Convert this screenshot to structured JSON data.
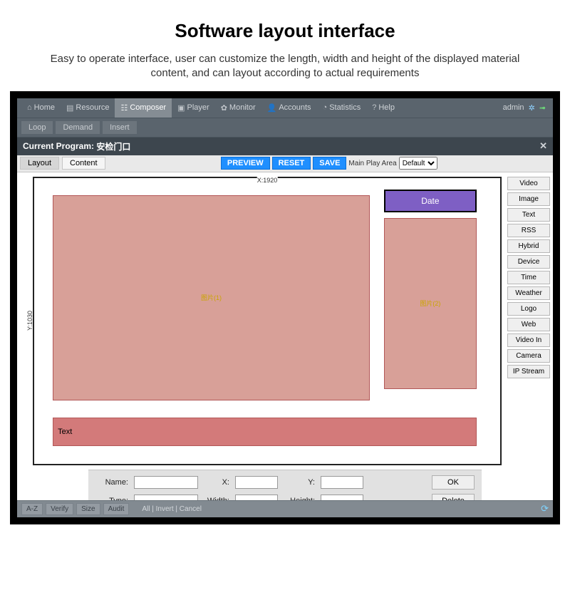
{
  "page": {
    "title": "Software layout interface",
    "subtitle": "Easy to operate interface, user can customize the length, width and height of the displayed material content, and can layout according to actual requirements"
  },
  "topnav": {
    "items": [
      {
        "label": "Home",
        "icon": "⌂"
      },
      {
        "label": "Resource",
        "icon": "▤"
      },
      {
        "label": "Composer",
        "icon": "☷",
        "active": true
      },
      {
        "label": "Player",
        "icon": "▣"
      },
      {
        "label": "Monitor",
        "icon": "✿"
      },
      {
        "label": "Accounts",
        "icon": "👤"
      },
      {
        "label": "Statistics",
        "icon": "◔"
      },
      {
        "label": "Help",
        "icon": "?"
      }
    ],
    "user": "admin"
  },
  "subtabs": [
    "Loop",
    "Demand",
    "Insert"
  ],
  "program": {
    "label_prefix": "Current Program:",
    "name": "安检门口"
  },
  "editor": {
    "tabs": [
      "Layout",
      "Content"
    ],
    "active_tab": "Layout",
    "buttons": {
      "preview": "PREVIEW",
      "reset": "RESET",
      "save": "SAVE"
    },
    "main_play_area_label": "Main Play Area",
    "main_play_area_value": "Default",
    "ruler": {
      "x": "X:1920",
      "y": "Y:1030"
    }
  },
  "regions": {
    "pic1": "图片(1)",
    "pic2": "图片(2)",
    "date": "Date",
    "text": "Text"
  },
  "palette": [
    "Video",
    "Image",
    "Text",
    "RSS",
    "Hybrid",
    "Device",
    "Time",
    "Weather",
    "Logo",
    "Web",
    "Video In",
    "Camera",
    "IP Stream"
  ],
  "props": {
    "name_label": "Name:",
    "name": "",
    "x_label": "X:",
    "x": "",
    "y_label": "Y:",
    "y": "",
    "type_label": "Type:",
    "type": "",
    "width_label": "Width:",
    "width": "",
    "height_label": "Height:",
    "height": "",
    "ok": "OK",
    "delete": "Delete"
  },
  "bottom": {
    "buttons": [
      "A-Z",
      "Verify",
      "Size",
      "Audit"
    ],
    "actions": "All | Invert | Cancel"
  }
}
